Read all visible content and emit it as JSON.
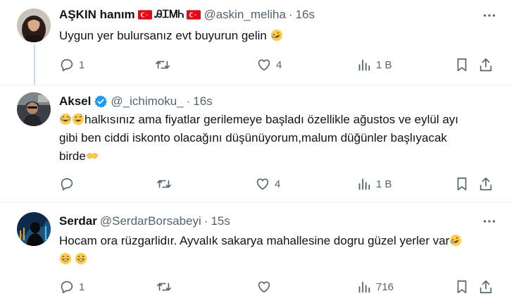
{
  "tweets": [
    {
      "name": "AŞKIN hanım",
      "name_extra": "ᎯᏆᎷᏂ",
      "handle": "@askin_meliha",
      "time": "16s",
      "text": "Uygun yer bulursanız evt buyurun gelin",
      "replies": "1",
      "retweets": "",
      "likes": "4",
      "views": "1 B"
    },
    {
      "name": "Aksel",
      "handle": "@_ichimoku_",
      "time": "16s",
      "text_lines": [
        "halkısınız ama fiyatlar gerilemeye başladı özellikle ağustos ve eylül ayı",
        "gibi ben ciddi iskonto olacağını düşünüyorum,malum düğünler başlıyacak",
        "birde"
      ],
      "replies": "",
      "retweets": "",
      "likes": "4",
      "views": "1 B"
    },
    {
      "name": "Serdar",
      "handle": "@SerdarBorsabeyi",
      "time": "15s",
      "text": "Hocam ora rüzgarlidır. Ayvalık sakarya mahallesine dogru güzel yerler var",
      "replies": "1",
      "retweets": "",
      "likes": "",
      "views": "716"
    }
  ],
  "separator": "·",
  "icons": {
    "reply": "reply-icon",
    "retweet": "retweet-icon",
    "like": "heart-icon",
    "views": "views-icon",
    "bookmark": "bookmark-icon",
    "share": "share-icon",
    "more": "more-icon",
    "verified": "verified-badge-icon"
  },
  "colors": {
    "text": "#0f1419",
    "secondary": "#536471",
    "verified": "#1d9bf0",
    "divider": "#eff3f4",
    "thread_line": "#cfd9de"
  }
}
